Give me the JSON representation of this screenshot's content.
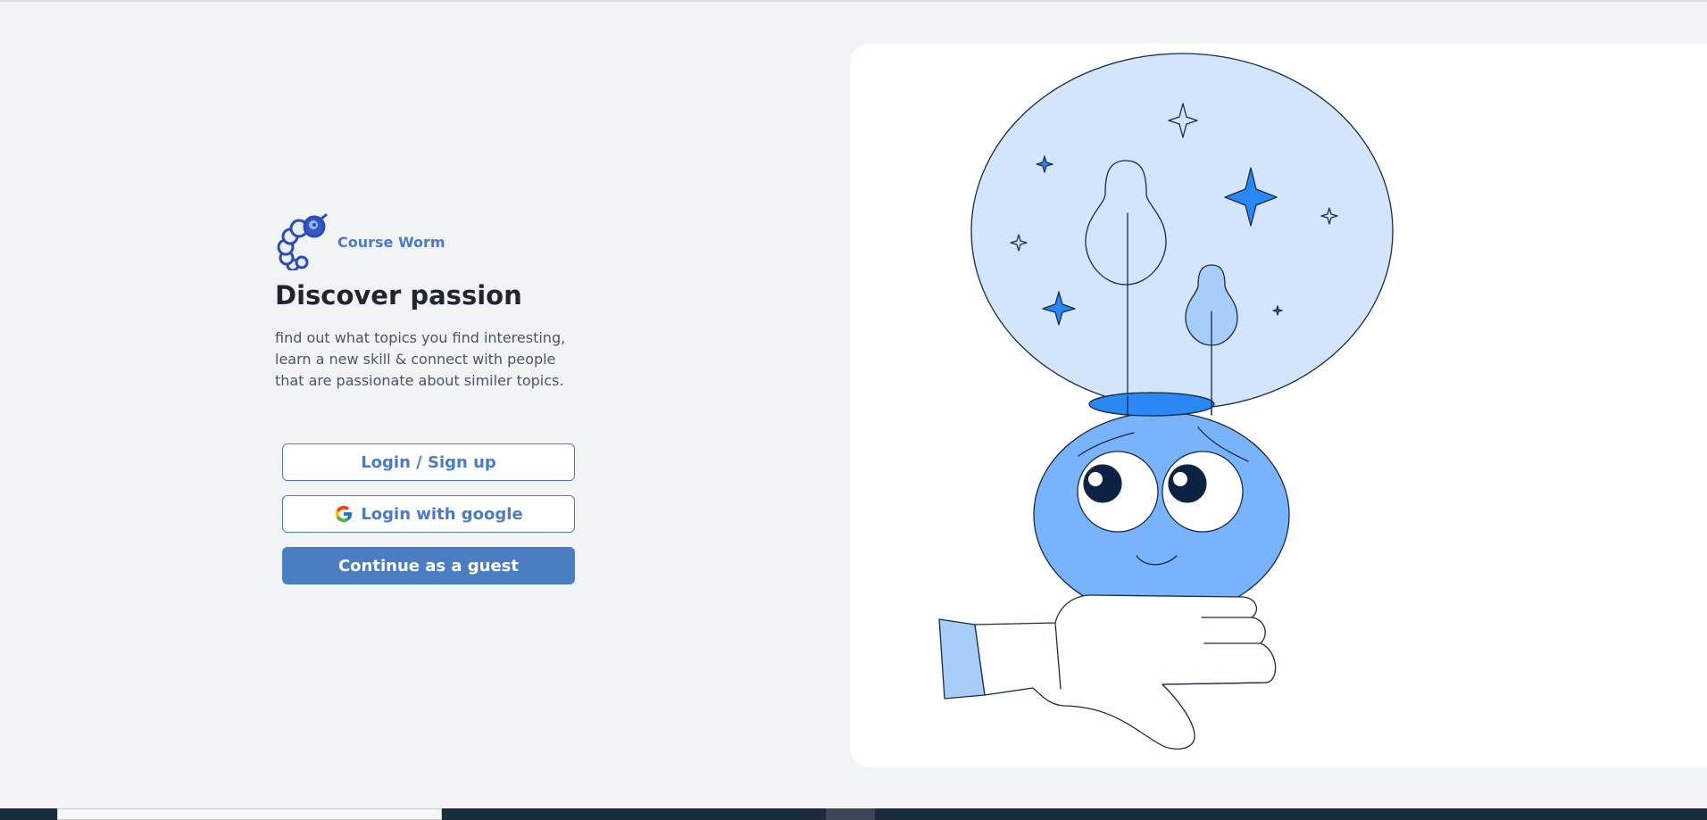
{
  "brand": {
    "name": "Course Worm",
    "logo_icon": "worm-logo-icon",
    "color": "#4a7cc4"
  },
  "hero": {
    "heading": "Discover passion",
    "description": "find out what topics you find interesting, learn a new skill & connect with people that are passionate about similer topics."
  },
  "actions": {
    "login_label": "Login / Sign up",
    "google_label": "Login with google",
    "google_icon": "google-icon",
    "guest_label": "Continue as a guest"
  },
  "illustration": {
    "icon": "idea-head-illustration"
  },
  "colors": {
    "accent": "#4a7cc4",
    "background": "#f2f3f5",
    "heading": "#1f2630",
    "bubble": "#d3e5fb",
    "head": "#78b3fb",
    "star": "#2a88f5"
  }
}
